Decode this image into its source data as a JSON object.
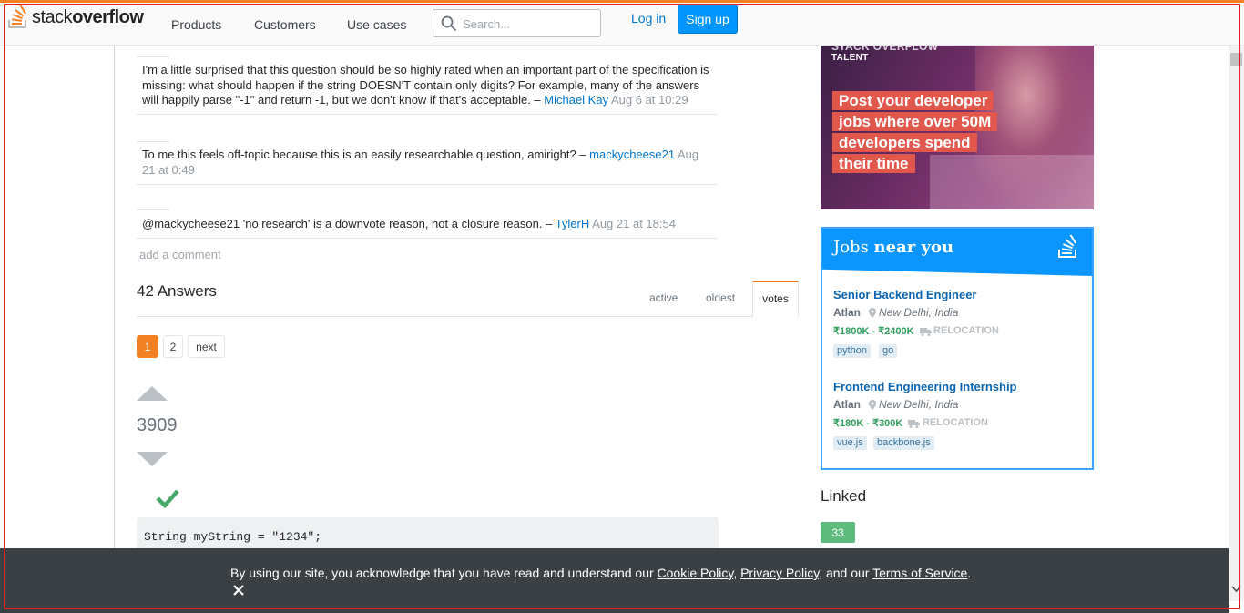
{
  "header": {
    "logo_prefix": "stack",
    "logo_suffix": "overflow",
    "nav": [
      "Products",
      "Customers",
      "Use cases"
    ],
    "search_placeholder": "Search...",
    "login": "Log in",
    "signup": "Sign up",
    "accent": "#f48024"
  },
  "comments": [
    {
      "text": "I'm a little surprised that this question should be so highly rated when an important part of the specification is missing: what should happen if the string DOESN'T contain only digits? For example, many of the answers will happily parse \"-1\" and return -1, but we don't know if that's acceptable. – ",
      "user": "Michael Kay",
      "date": "Aug 6 at 10:29"
    },
    {
      "text": "To me this feels off-topic because this is an easily researchable question, amiright? – ",
      "user": "mackycheese21",
      "date": "Aug 21 at 0:49"
    },
    {
      "text": "@mackycheese21 'no research' is a downvote reason, not a closure reason. – ",
      "user": "TylerH",
      "date": "Aug 21 at 18:54"
    }
  ],
  "add_comment": "add a comment",
  "answers": {
    "title": "42 Answers",
    "tabs": [
      "active",
      "oldest",
      "votes"
    ],
    "active_tab": "votes",
    "pages": [
      "1",
      "2",
      "next"
    ],
    "current_page": "1"
  },
  "answer": {
    "votes": "3909",
    "accepted": true,
    "code": "String myString = \"1234\";"
  },
  "ad": {
    "brand": "STACK OVERFLOW",
    "brand_sub": "TALENT",
    "lines": [
      "Post your developer",
      "jobs where over 50M",
      "developers spend",
      "their time"
    ],
    "highlight_color": "#e2574c"
  },
  "jobs": {
    "title_plain": "Jobs ",
    "title_bold": "near you",
    "items": [
      {
        "title": "Senior Backend Engineer",
        "company": "Atlan",
        "location": "New Delhi, India",
        "salary": "₹1800K - ₹2400K",
        "relocation": "RELOCATION",
        "tags": [
          "python",
          "go"
        ]
      },
      {
        "title": "Frontend Engineering Internship",
        "company": "Atlan",
        "location": "New Delhi, India",
        "salary": "₹180K - ₹300K",
        "relocation": "RELOCATION",
        "tags": [
          "vue.js",
          "backbone.js"
        ]
      }
    ]
  },
  "linked": {
    "title": "Linked",
    "first_count": "33"
  },
  "cookie": {
    "prefix": "By using our site, you acknowledge that you have read and understand our ",
    "cookie_policy": "Cookie Policy",
    "sep1": ", ",
    "privacy_policy": "Privacy Policy",
    "sep2": ", and our ",
    "terms": "Terms of Service",
    "suffix": "."
  }
}
